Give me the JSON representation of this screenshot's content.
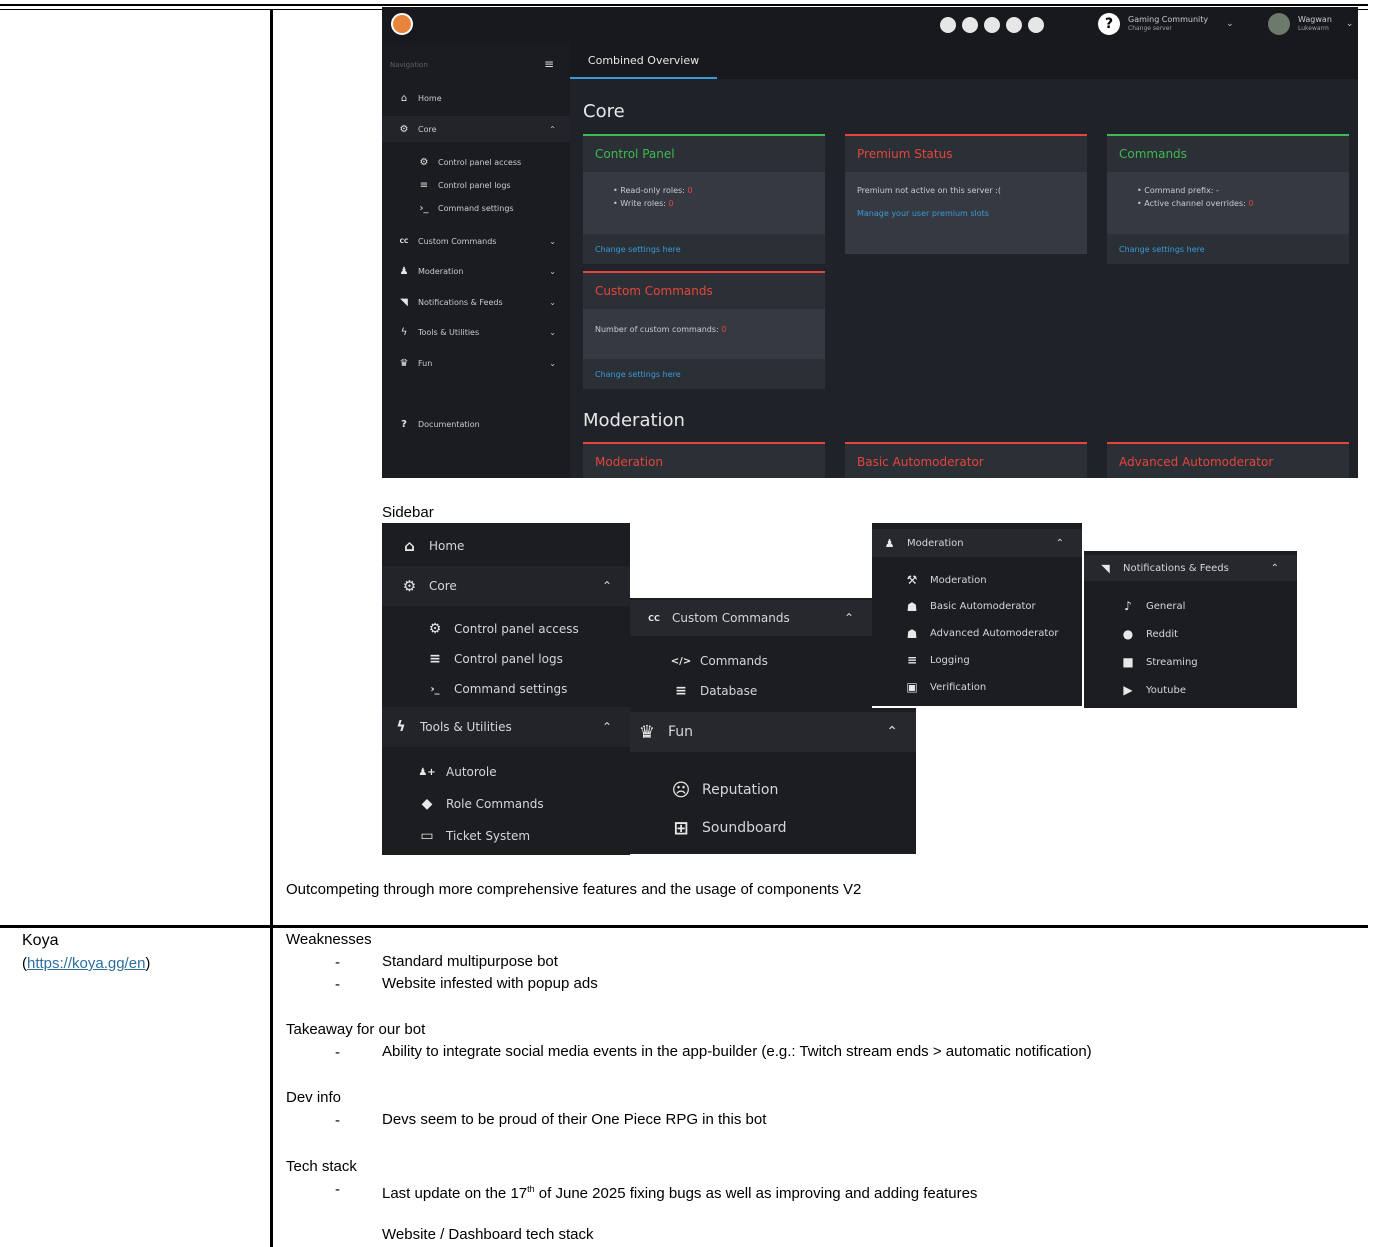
{
  "dashboard": {
    "nav_header": "Navigation",
    "topbar": {
      "server_name": "Gaming Community",
      "server_sub": "Change server",
      "user_name": "Wagwan",
      "user_sub": "Lukewarm"
    },
    "tab": "Combined Overview",
    "nav": [
      {
        "icon": "home-icon",
        "glyph": "⌂",
        "label": "Home",
        "chevron": ""
      },
      {
        "icon": "cogs-icon",
        "glyph": "⚙",
        "label": "Core",
        "chevron": "⌃"
      }
    ],
    "core_sub": [
      {
        "icon": "gear-icon",
        "glyph": "⚙",
        "label": "Control panel access"
      },
      {
        "icon": "database-icon",
        "glyph": "≡",
        "label": "Control panel logs"
      },
      {
        "icon": "terminal-icon",
        "glyph": "›_",
        "label": "Command settings"
      }
    ],
    "nav2": [
      {
        "icon": "cc-icon",
        "glyph": "CC",
        "label": "Custom Commands",
        "chevron": "⌄"
      },
      {
        "icon": "moderation-icon",
        "glyph": "♟",
        "label": "Moderation",
        "chevron": "⌄"
      },
      {
        "icon": "rss-icon",
        "glyph": "◥",
        "label": "Notifications & Feeds",
        "chevron": "⌄"
      },
      {
        "icon": "bolt-icon",
        "glyph": "ϟ",
        "label": "Tools & Utilities",
        "chevron": "⌄"
      },
      {
        "icon": "trophy-icon",
        "glyph": "♛",
        "label": "Fun",
        "chevron": "⌄"
      }
    ],
    "documentation": "Documentation",
    "section_core": "Core",
    "section_moderation": "Moderation",
    "cards": {
      "control_panel": {
        "title": "Control Panel",
        "lines": [
          "• Read-only roles: 0",
          "• Write roles: 0"
        ],
        "footer": "Change settings here"
      },
      "premium": {
        "title": "Premium Status",
        "lines": [
          "Premium not active on this server :("
        ],
        "link": "Manage your user premium slots"
      },
      "commands": {
        "title": "Commands",
        "lines": [
          "• Command prefix: -",
          "• Active channel overrides: 0"
        ],
        "footer": "Change settings here"
      },
      "custom_commands": {
        "title": "Custom Commands",
        "lines": [
          "Number of custom commands: 0"
        ],
        "footer": "Change settings here"
      }
    },
    "mod_cards": [
      "Moderation",
      "Basic Automoderator",
      "Advanced Automoderator"
    ],
    "colors": {
      "green": "#3fb950",
      "red": "#e5453a",
      "link": "#3a9ad9"
    }
  },
  "sidebar_caption": "Sidebar",
  "panel1": {
    "items": [
      {
        "label": "Home",
        "glyph": "⌂",
        "icon": "home-icon"
      },
      {
        "label": "Core",
        "glyph": "⚙",
        "icon": "cogs-icon",
        "chevron": "⌃"
      }
    ],
    "sub": [
      {
        "label": "Control panel access",
        "glyph": "⚙",
        "icon": "gear-icon"
      },
      {
        "label": "Control panel logs",
        "glyph": "≡",
        "icon": "database-icon"
      },
      {
        "label": "Command settings",
        "glyph": "›_",
        "icon": "terminal-icon"
      }
    ],
    "tools": {
      "label": "Tools & Utilities",
      "glyph": "ϟ",
      "icon": "bolt-icon",
      "chevron": "⌃"
    },
    "tools_sub": [
      {
        "label": "Autorole",
        "glyph": "♟+",
        "icon": "user-plus-icon"
      },
      {
        "label": "Role Commands",
        "glyph": "◆",
        "icon": "tags-icon"
      },
      {
        "label": "Ticket System",
        "glyph": "▭",
        "icon": "ticket-icon"
      }
    ]
  },
  "panel2": {
    "header": {
      "label": "Custom Commands",
      "glyph": "CC",
      "icon": "cc-icon",
      "chevron": "⌃"
    },
    "sub": [
      {
        "label": "Commands",
        "glyph": "</>",
        "icon": "code-icon"
      },
      {
        "label": "Database",
        "glyph": "≡",
        "icon": "database-icon"
      }
    ]
  },
  "panel3": {
    "header": {
      "label": "Fun",
      "glyph": "♛",
      "icon": "trophy-icon",
      "chevron": "⌃"
    },
    "sub": [
      {
        "label": "Reputation",
        "glyph": "☹",
        "icon": "frown-icon"
      },
      {
        "label": "Soundboard",
        "glyph": "⊞",
        "icon": "grid-icon"
      }
    ]
  },
  "panel4": {
    "header": {
      "label": "Moderation",
      "glyph": "♟",
      "icon": "moderation-icon",
      "chevron": "⌃"
    },
    "sub": [
      {
        "label": "Moderation",
        "glyph": "⚒",
        "icon": "gavel-icon"
      },
      {
        "label": "Basic Automoderator",
        "glyph": "☗",
        "icon": "robot-icon"
      },
      {
        "label": "Advanced Automoderator",
        "glyph": "☗",
        "icon": "robot-icon"
      },
      {
        "label": "Logging",
        "glyph": "≡",
        "icon": "database-icon"
      },
      {
        "label": "Verification",
        "glyph": "▣",
        "icon": "id-card-icon"
      }
    ]
  },
  "panel5": {
    "header": {
      "label": "Notifications & Feeds",
      "glyph": "◥",
      "icon": "rss-icon",
      "chevron": "⌃"
    },
    "sub": [
      {
        "label": "General",
        "glyph": "♪",
        "icon": "bell-icon"
      },
      {
        "label": "Reddit",
        "glyph": "●",
        "icon": "reddit-icon"
      },
      {
        "label": "Streaming",
        "glyph": "■",
        "icon": "video-icon"
      },
      {
        "label": "Youtube",
        "glyph": "▶",
        "icon": "youtube-icon"
      }
    ]
  },
  "doc": {
    "outcompeting": "Outcompeting through more comprehensive features and the usage of components V2",
    "koya_name": "Koya",
    "koya_link": "https://koya.gg/en",
    "weaknesses_title": "Weaknesses",
    "weaknesses": [
      "Standard multipurpose bot",
      "Website infested with popup ads"
    ],
    "takeaway_title": "Takeaway for our bot",
    "takeaway": [
      "Ability to integrate social media events in the app-builder (e.g.: Twitch stream ends > automatic notification)"
    ],
    "devinfo_title": "Dev info",
    "devinfo": [
      "Devs seem to be proud of their One Piece RPG in this bot"
    ],
    "techstack_title": "Tech stack",
    "tech_line_a": "Last update on the 17",
    "tech_line_sup": "th",
    "tech_line_b": " of June 2025 fixing bugs as well as improving and adding features",
    "website_stack": "Website / Dashboard tech stack",
    "dash_char": "-"
  }
}
